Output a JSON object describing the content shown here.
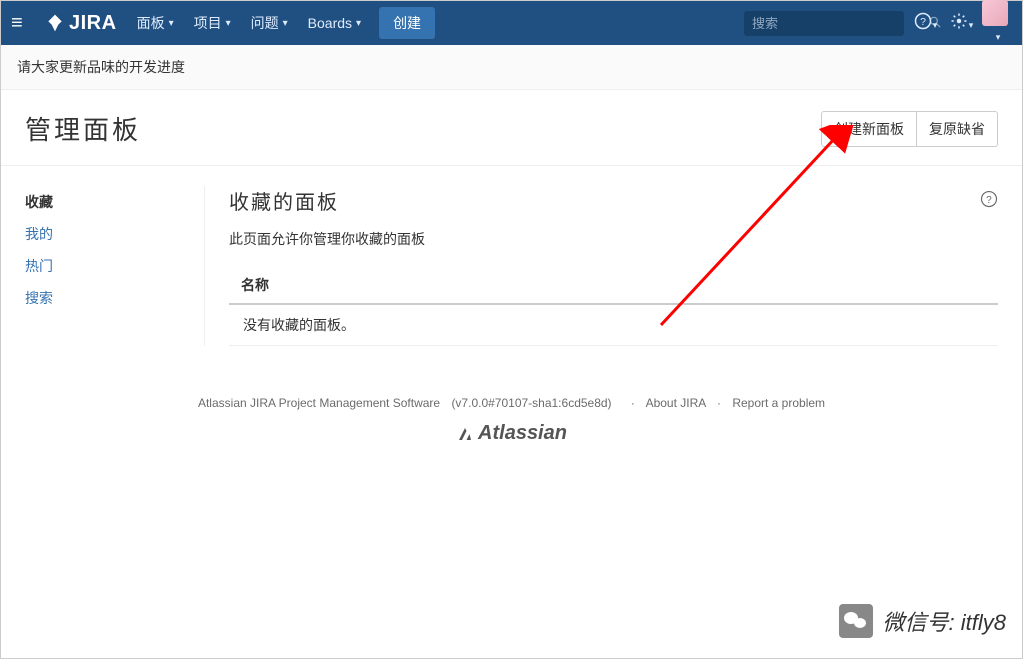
{
  "nav": {
    "items": [
      "面板",
      "项目",
      "问题",
      "Boards"
    ],
    "create": "创建",
    "search_placeholder": "搜索"
  },
  "notice": "请大家更新品味的开发进度",
  "page": {
    "title": "管理面板",
    "btn_create": "创建新面板",
    "btn_restore": "复原缺省"
  },
  "sidebar": {
    "items": [
      "收藏",
      "我的",
      "热门",
      "搜索"
    ]
  },
  "main": {
    "heading": "收藏的面板",
    "desc": "此页面允许你管理你收藏的面板",
    "col_name": "名称",
    "empty": "没有收藏的面板。"
  },
  "footer": {
    "line1_a": "Atlassian JIRA Project Management Software",
    "line1_b": "(v7.0.0#70107-sha1:6cd5e8d)",
    "about": "About JIRA",
    "report": "Report a problem",
    "brand": "Atlassian"
  },
  "watermark": {
    "label": "微信号",
    "value": "itfly8"
  }
}
